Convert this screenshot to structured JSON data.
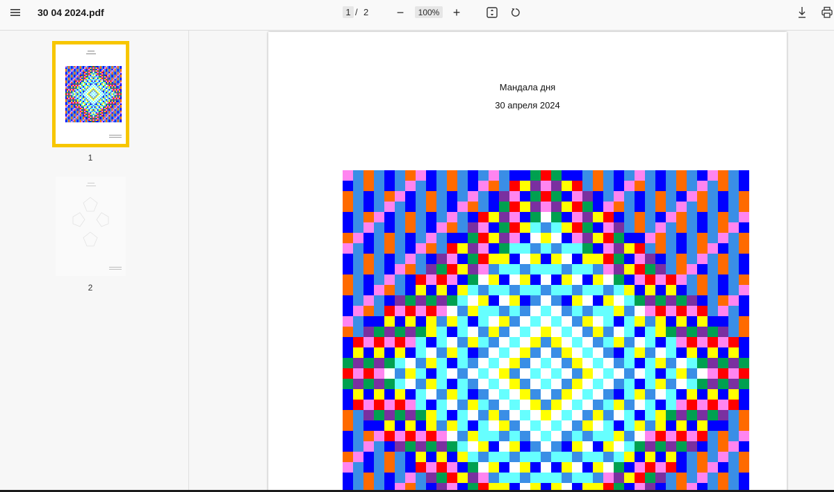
{
  "toolbar": {
    "menu_icon": "hamburger-menu-icon",
    "file_name": "30 04 2024.pdf",
    "current_page": "1",
    "separator": "/",
    "total_pages": "2",
    "zoom_out": "−",
    "zoom_level": "100%",
    "zoom_in": "+",
    "fit_icon": "fit-page-icon",
    "rotate_icon": "rotate-icon",
    "download_icon": "download-icon",
    "print_icon": "print-icon"
  },
  "sidebar": {
    "thumbnails": [
      {
        "label": "1",
        "active": true
      },
      {
        "label": "2",
        "active": false
      }
    ]
  },
  "document": {
    "title": "Мандала дня",
    "date": "30 апреля 2024"
  },
  "colors": {
    "highlight": "#f7c600",
    "palette": [
      "#ffffff",
      "#ff6a00",
      "#3a8ee6",
      "#0000ff",
      "#ff85f0",
      "#7a30a0",
      "#ffff00",
      "#66ffff",
      "#00a050",
      "#ff0000"
    ]
  }
}
